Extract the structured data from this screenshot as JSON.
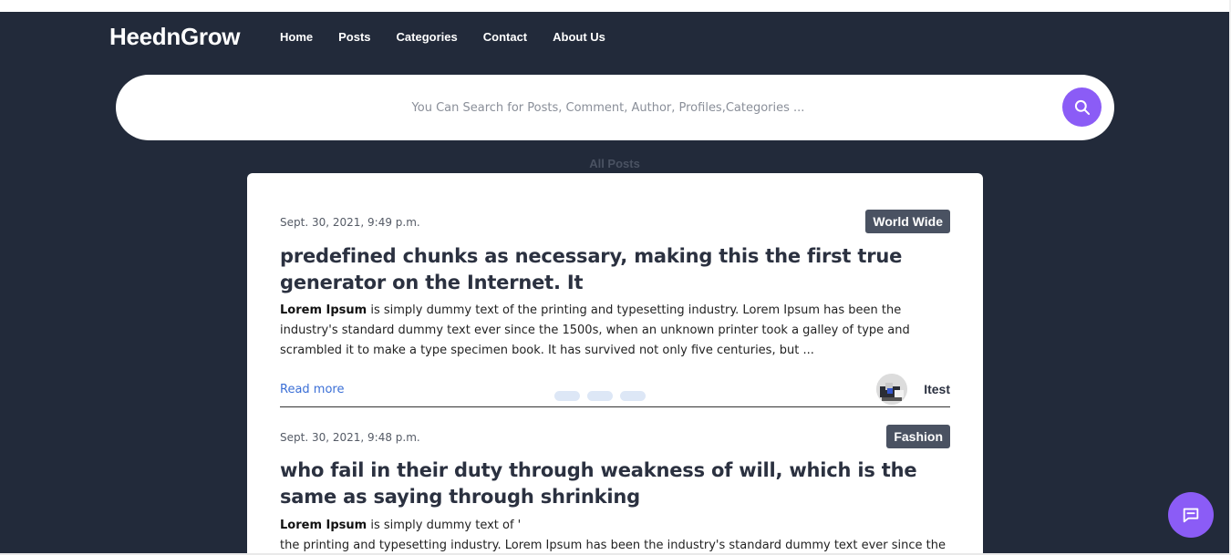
{
  "brand": "HeednGrow",
  "nav": [
    "Home",
    "Posts",
    "Categories",
    "Contact",
    "About Us"
  ],
  "search": {
    "placeholder": "You Can Search for Posts, Comment, Author, Profiles,Categories ...",
    "button_icon": "search-icon"
  },
  "section_title": "All Posts",
  "posts": [
    {
      "date": "Sept. 30, 2021, 9:49 p.m.",
      "category": "World Wide",
      "title": "predefined chunks as necessary, making this the first true generator on the Internet. It",
      "excerpt_bold": "Lorem Ipsum",
      "excerpt_rest": " is simply dummy text of the printing and typesetting industry. Lorem Ipsum has been the industry's standard dummy text ever since the 1500s, when an unknown printer took a galley of type and scrambled it to make a type specimen book. It has survived not only five centuries, but ...",
      "read_more": "Read more",
      "author": "Itest"
    },
    {
      "date": "Sept. 30, 2021, 9:48 p.m.",
      "category": "Fashion",
      "title": "who fail in their duty through weakness of will, which is the same as saying through shrinking",
      "excerpt_bold": "Lorem Ipsum",
      "excerpt_rest": " is simply dummy text of '",
      "excerpt_line2": "the printing and typesetting industry. Lorem Ipsum has been the industry's standard dummy text ever since the"
    }
  ],
  "colors": {
    "background": "#222a3a",
    "accent": "#8b5cf6",
    "badge": "#4a5262",
    "link": "#3b6fd6"
  },
  "chat_icon": "chat-bubble-icon"
}
